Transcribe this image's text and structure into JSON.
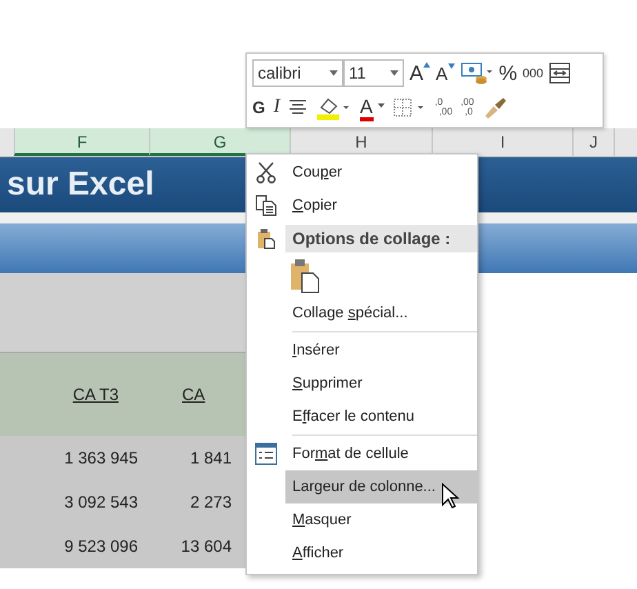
{
  "columns": [
    {
      "label": "F",
      "selected": true
    },
    {
      "label": "G",
      "selected": true
    },
    {
      "label": "H",
      "selected": false
    },
    {
      "label": "I",
      "selected": false
    },
    {
      "label": "J",
      "selected": false
    }
  ],
  "sheet": {
    "title": "sur Excel",
    "headers": [
      "CA T3",
      "CA"
    ],
    "rows": [
      [
        "1 363 945",
        "1 841"
      ],
      [
        "3 092 543",
        "2 273"
      ],
      [
        "9 523 096",
        "13 604"
      ]
    ]
  },
  "mini_toolbar": {
    "font": "calibri",
    "size": "11",
    "row1": [
      {
        "kind": "grow",
        "text": "A"
      },
      {
        "kind": "shrink",
        "text": "A"
      },
      {
        "kind": "accounting"
      },
      {
        "kind": "text",
        "text": "%"
      },
      {
        "kind": "small",
        "text": "000"
      },
      {
        "kind": "wrap"
      }
    ],
    "row2": [
      {
        "kind": "bold",
        "text": "G"
      },
      {
        "kind": "italic",
        "text": "I"
      },
      {
        "kind": "align"
      },
      {
        "kind": "fill"
      },
      {
        "kind": "fontcolor",
        "text": "A"
      },
      {
        "kind": "borders"
      },
      {
        "kind": "decimal",
        "digits": [
          ",0",
          ",00"
        ]
      },
      {
        "kind": "decimal",
        "digits": [
          ",00",
          ",0"
        ]
      },
      {
        "kind": "brush"
      }
    ]
  },
  "context_menu": [
    {
      "kind": "cut",
      "pre": "Cou",
      "key": "p",
      "post": "er",
      "selected": false
    },
    {
      "kind": "copy",
      "key": "C",
      "post": "opier",
      "selected": false
    },
    {
      "kind": "header",
      "label": "Options de collage :"
    },
    {
      "kind": "paste"
    },
    {
      "kind": "item",
      "pre": "Collage ",
      "key": "s",
      "post": "pécial...",
      "selected": false
    },
    {
      "kind": "separator"
    },
    {
      "kind": "item",
      "key": "I",
      "post": "nsérer",
      "selected": false
    },
    {
      "kind": "item",
      "key": "S",
      "post": "upprimer",
      "selected": false
    },
    {
      "kind": "item",
      "pre": "E",
      "key": "f",
      "post": "facer le contenu",
      "selected": false
    },
    {
      "kind": "separator"
    },
    {
      "kind": "format",
      "pre": "For",
      "key": "m",
      "post": "at de cellule",
      "selected": false
    },
    {
      "kind": "item",
      "pre": "Lar",
      "key": "g",
      "post": "eur de colonne...",
      "selected": true
    },
    {
      "kind": "item",
      "key": "M",
      "post": "asquer",
      "selected": false
    },
    {
      "kind": "item",
      "key": "A",
      "post": "fficher",
      "selected": false
    }
  ]
}
